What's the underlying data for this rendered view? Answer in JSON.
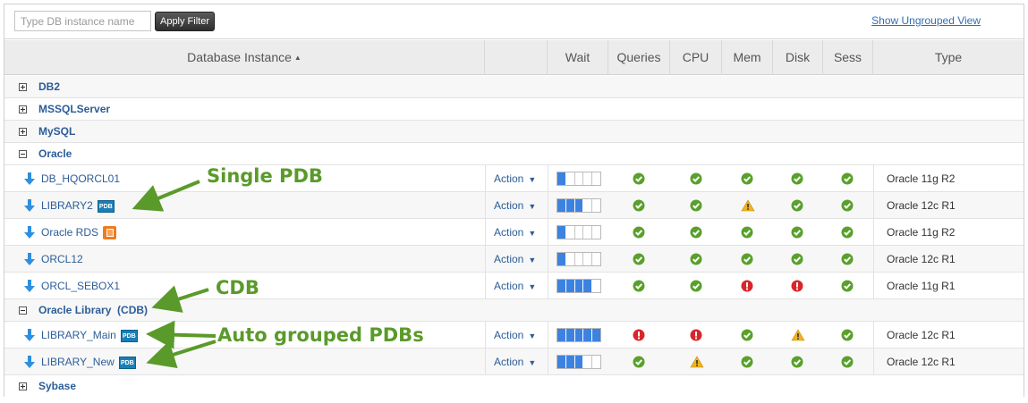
{
  "filter": {
    "placeholder": "Type DB instance name",
    "apply_label": "Apply Filter"
  },
  "ungrouped_link": "Show Ungrouped View",
  "columns": {
    "instance": "Database Instance",
    "wait": "Wait",
    "queries": "Queries",
    "cpu": "CPU",
    "mem": "Mem",
    "disk": "Disk",
    "sess": "Sess",
    "type": "Type"
  },
  "groups": {
    "db2": "DB2",
    "mssql": "MSSQLServer",
    "mysql": "MySQL",
    "oracle": "Oracle",
    "oracle_library": "Oracle Library  (CDB)",
    "sybase": "Sybase"
  },
  "rows": [
    {
      "name": "DB_HQORCL01",
      "badge": "",
      "action": "Action",
      "wait_level": 1,
      "queries": "ok",
      "cpu": "ok",
      "mem": "ok",
      "disk": "ok",
      "sess": "ok",
      "type": "Oracle 11g R2"
    },
    {
      "name": "LIBRARY2",
      "badge": "PDB",
      "action": "Action",
      "wait_level": 3,
      "queries": "ok",
      "cpu": "ok",
      "mem": "warning",
      "disk": "ok",
      "sess": "ok",
      "type": "Oracle 12c R1"
    },
    {
      "name": "Oracle RDS",
      "badge": "rds",
      "action": "Action",
      "wait_level": 1,
      "queries": "ok",
      "cpu": "ok",
      "mem": "ok",
      "disk": "ok",
      "sess": "ok",
      "type": "Oracle 11g R2"
    },
    {
      "name": "ORCL12",
      "badge": "",
      "action": "Action",
      "wait_level": 1,
      "queries": "ok",
      "cpu": "ok",
      "mem": "ok",
      "disk": "ok",
      "sess": "ok",
      "type": "Oracle 12c R1"
    },
    {
      "name": "ORCL_SEBOX1",
      "badge": "",
      "action": "Action",
      "wait_level": 4,
      "queries": "ok",
      "cpu": "ok",
      "mem": "error",
      "disk": "error",
      "sess": "ok",
      "type": "Oracle 11g R1"
    },
    {
      "name": "LIBRARY_Main",
      "badge": "PDB",
      "action": "Action",
      "wait_level": 5,
      "queries": "error",
      "cpu": "error",
      "mem": "ok",
      "disk": "warning",
      "sess": "ok",
      "type": "Oracle 12c R1"
    },
    {
      "name": "LIBRARY_New",
      "badge": "PDB",
      "action": "Action",
      "wait_level": 3,
      "queries": "ok",
      "cpu": "warning",
      "mem": "ok",
      "disk": "ok",
      "sess": "ok",
      "type": "Oracle 12c R1"
    }
  ],
  "callouts": {
    "single_pdb": "Single PDB",
    "cdb": "CDB",
    "auto_grouped": "Auto grouped PDBs"
  },
  "colors": {
    "ok": "#5aa02c",
    "error": "#d9262a",
    "warning": "#f0b41c",
    "wait_fill": "#3c82e0",
    "callout": "#5a9a2a",
    "link": "#2c5d98"
  }
}
